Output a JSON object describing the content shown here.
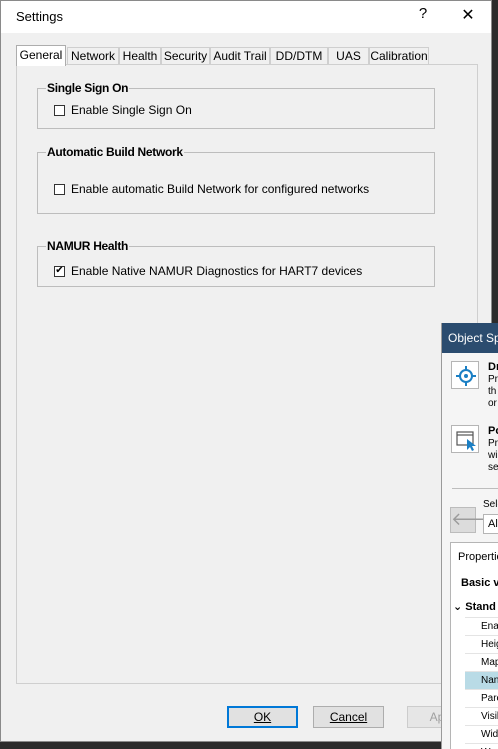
{
  "dialog": {
    "title": "Settings",
    "help_label": "?",
    "close_label": "✕",
    "tabs": [
      {
        "label": "General",
        "active": true
      },
      {
        "label": "Network",
        "active": false
      },
      {
        "label": "Health",
        "active": false
      },
      {
        "label": "Security",
        "active": false
      },
      {
        "label": "Audit Trail",
        "active": false
      },
      {
        "label": "DD/DTM",
        "active": false
      },
      {
        "label": "UAS",
        "active": false
      },
      {
        "label": "Calibration",
        "active": false
      }
    ],
    "groups": {
      "sso": {
        "title": "Single Sign On",
        "checkbox_label": "Enable Single Sign On",
        "checked": false
      },
      "abn": {
        "title": "Automatic Build Network",
        "checkbox_label": "Enable automatic Build Network for configured networks",
        "checked": false
      },
      "namur": {
        "title": "NAMUR Health",
        "checkbox_label": "Enable Native NAMUR Diagnostics for HART7 devices",
        "checked": true
      }
    },
    "buttons": {
      "ok": "OK",
      "cancel": "Cancel",
      "apply": "Ap"
    }
  },
  "side_panel": {
    "title": "Object Sp",
    "item1": {
      "title": "Dı",
      "lines": [
        "Pr",
        "th",
        "or"
      ]
    },
    "item2": {
      "title": "Po",
      "lines": [
        "Pr",
        "wi",
        "se"
      ]
    },
    "select_label": "Sele",
    "select_value": "Ali",
    "properties_header": "Propertie",
    "basic_view": "Basic v",
    "category": "Stand",
    "rows": [
      "Ena",
      "Heig",
      "Map",
      "Nan",
      "Pare",
      "Visil",
      "Widi",
      "Wo"
    ],
    "selected_row": 3
  }
}
